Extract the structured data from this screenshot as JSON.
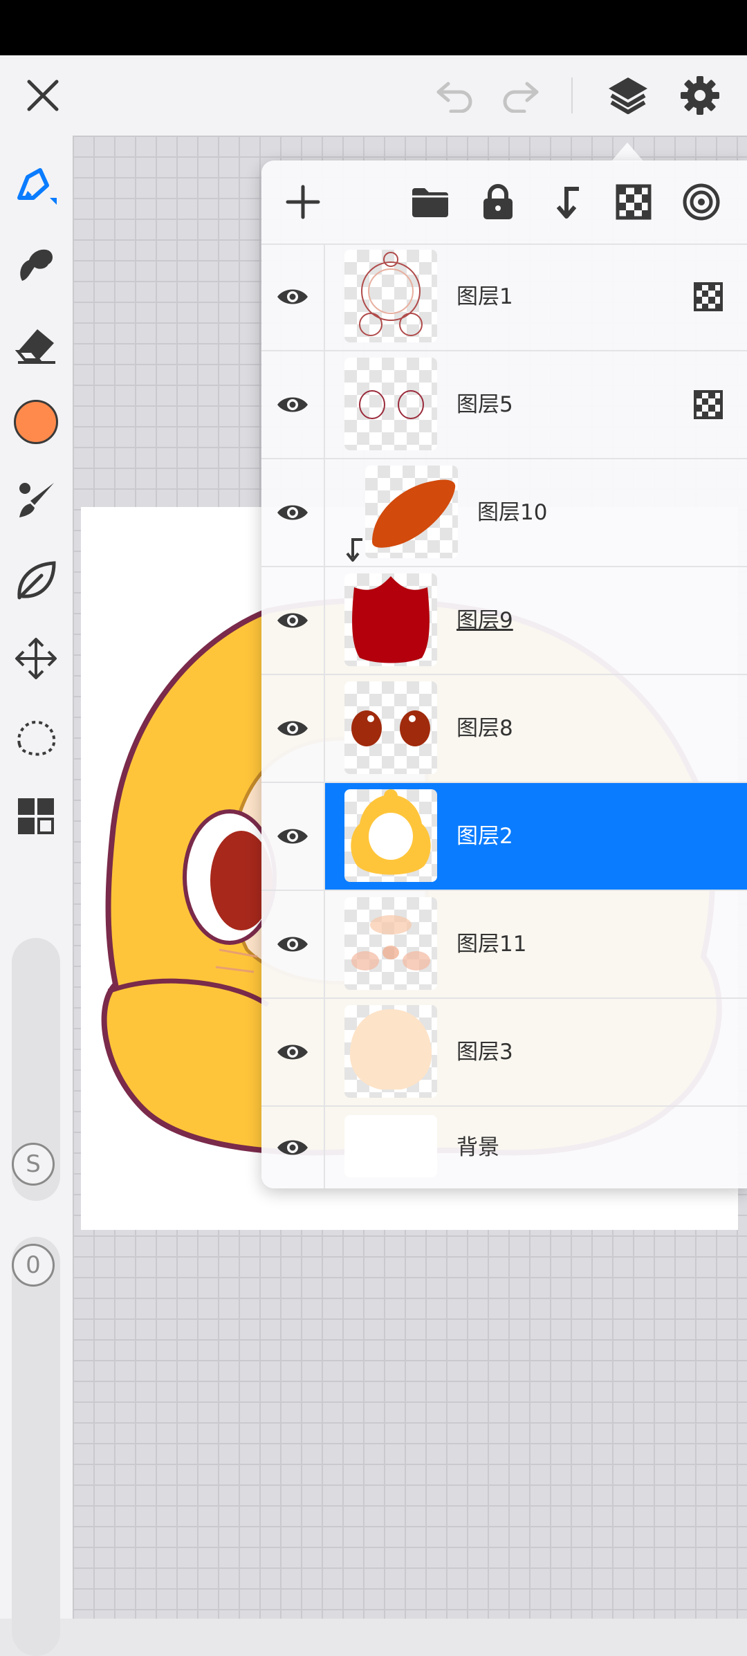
{
  "colors": {
    "accent": "#0a7cff",
    "brush": "#ff8a4c",
    "icon": "#3a3a3a",
    "disabled": "#c4c4c4"
  },
  "top_bar": {
    "icons": [
      "close-icon",
      "undo-icon",
      "redo-icon",
      "layers-icon",
      "settings-icon"
    ]
  },
  "left_toolbar": {
    "tools": [
      "brush-tool",
      "smudge-tool",
      "eraser-tool",
      "color-swatch",
      "brush-settings-tool",
      "lasso-fill-tool",
      "move-tool",
      "selection-tool",
      "gallery-tool"
    ],
    "size_slider_label": "S",
    "opacity_slider_label": "0"
  },
  "layer_panel": {
    "toolbar_icons": [
      "add-layer-icon",
      "folder-icon",
      "lock-icon",
      "clip-icon",
      "transparency-icon",
      "target-icon"
    ],
    "layers": [
      {
        "name": "图层1",
        "visible": true,
        "alpha_lock": true,
        "clipped": false,
        "selected": false
      },
      {
        "name": "图层5",
        "visible": true,
        "alpha_lock": true,
        "clipped": false,
        "selected": false
      },
      {
        "name": "图层10",
        "visible": true,
        "alpha_lock": false,
        "clipped": true,
        "selected": false
      },
      {
        "name": "图层9",
        "visible": true,
        "alpha_lock": false,
        "clipped": false,
        "selected": false
      },
      {
        "name": "图层8",
        "visible": true,
        "alpha_lock": false,
        "clipped": false,
        "selected": false
      },
      {
        "name": "图层2",
        "visible": true,
        "alpha_lock": false,
        "clipped": false,
        "selected": true
      },
      {
        "name": "图层11",
        "visible": true,
        "alpha_lock": false,
        "clipped": false,
        "selected": false
      },
      {
        "name": "图层3",
        "visible": true,
        "alpha_lock": false,
        "clipped": false,
        "selected": false
      },
      {
        "name": "背景",
        "visible": true,
        "alpha_lock": false,
        "clipped": false,
        "selected": false
      }
    ]
  }
}
